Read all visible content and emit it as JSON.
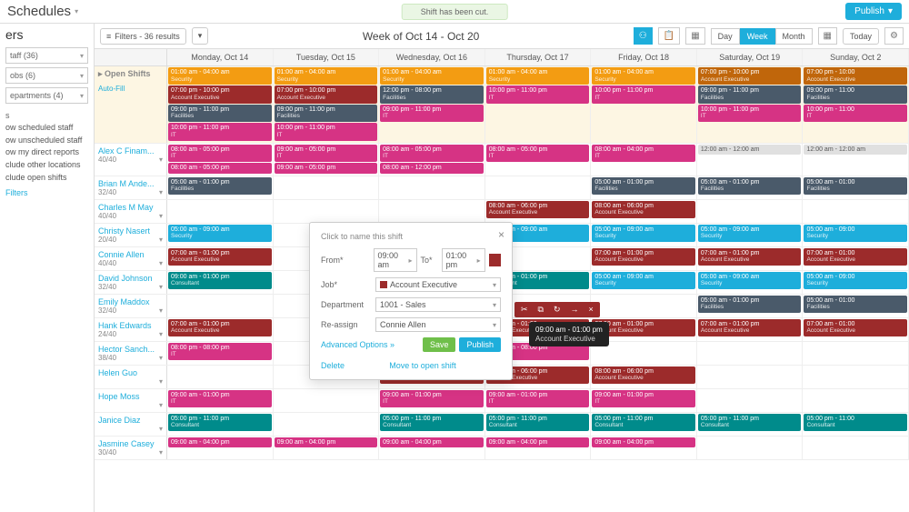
{
  "header": {
    "title": "Schedules",
    "notification": "Shift has been cut.",
    "publish": "Publish"
  },
  "sidebar": {
    "title": "ers",
    "staff": "taff (36)",
    "jobs": "obs (6)",
    "departments": "epartments (4)",
    "options_head": "s",
    "options": [
      "ow scheduled staff",
      "ow unscheduled staff",
      "ow my direct reports",
      "clude other locations",
      "clude open shifts"
    ],
    "clear": "Filters"
  },
  "toolbar": {
    "filters": "Filters - 36 results",
    "week": "Week of Oct 14 - Oct 20",
    "views": {
      "day": "Day",
      "week": "Week",
      "month": "Month",
      "today": "Today"
    }
  },
  "days": [
    "Monday, Oct 14",
    "Tuesday, Oct 15",
    "Wednesday, Oct 16",
    "Thursday, Oct 17",
    "Friday, Oct 18",
    "Saturday, Oct 19",
    "Sunday, Oct 2"
  ],
  "open_label": "Open Shifts",
  "autofill": "Auto-Fill",
  "open_shifts": [
    [
      {
        "t": "01:00 am - 04:00 am",
        "j": "Security",
        "c": "c-orange"
      },
      {
        "t": "07:00 pm - 10:00 pm",
        "j": "Account Executive",
        "c": "c-maroon"
      },
      {
        "t": "09:00 pm - 11:00 pm",
        "j": "Facilities",
        "c": "c-slate"
      },
      {
        "t": "10:00 pm - 11:00 pm",
        "j": "IT",
        "c": "c-pink"
      }
    ],
    [
      {
        "t": "01:00 am - 04:00 am",
        "j": "Security",
        "c": "c-orange"
      },
      {
        "t": "07:00 pm - 10:00 pm",
        "j": "Account Executive",
        "c": "c-maroon"
      },
      {
        "t": "09:00 pm - 11:00 pm",
        "j": "Facilities",
        "c": "c-slate"
      },
      {
        "t": "10:00 pm - 11:00 pm",
        "j": "IT",
        "c": "c-pink"
      }
    ],
    [
      {
        "t": "01:00 am - 04:00 am",
        "j": "Security",
        "c": "c-orange"
      },
      {
        "t": "12:00 pm - 08:00 pm",
        "j": "Facilities",
        "c": "c-slate"
      },
      {
        "t": "09:00 pm - 11:00 pm",
        "j": "IT",
        "c": "c-pink"
      }
    ],
    [
      {
        "t": "01:00 am - 04:00 am",
        "j": "Security",
        "c": "c-orange"
      },
      {
        "t": "10:00 pm - 11:00 pm",
        "j": "IT",
        "c": "c-pink"
      }
    ],
    [
      {
        "t": "01:00 am - 04:00 am",
        "j": "Security",
        "c": "c-orange"
      },
      {
        "t": "10:00 pm - 11:00 pm",
        "j": "IT",
        "c": "c-pink"
      }
    ],
    [
      {
        "t": "07:00 pm - 10:00 pm",
        "j": "Account Executive",
        "c": "c-dorange"
      },
      {
        "t": "09:00 pm - 11:00 pm",
        "j": "Facilities",
        "c": "c-slate"
      },
      {
        "t": "10:00 pm - 11:00 pm",
        "j": "IT",
        "c": "c-pink"
      }
    ],
    [
      {
        "t": "07:00 pm - 10:00",
        "j": "Account Executive",
        "c": "c-dorange"
      },
      {
        "t": "09:00 pm - 11:00",
        "j": "Facilities",
        "c": "c-slate"
      },
      {
        "t": "10:00 pm - 11:00",
        "j": "IT",
        "c": "c-pink"
      }
    ]
  ],
  "employees": [
    {
      "name": "Alex C Finam...",
      "hrs": "40/40",
      "cells": [
        [
          {
            "t": "08:00 am - 05:00 pm",
            "j": "IT",
            "c": "c-pink"
          },
          {
            "t": "08:00 am - 05:00 pm",
            "j": "",
            "c": "c-pink"
          }
        ],
        [
          {
            "t": "09:00 am - 05:00 pm",
            "j": "IT",
            "c": "c-pink"
          },
          {
            "t": "09:00 am - 05:00 pm",
            "j": "",
            "c": "c-pink"
          }
        ],
        [
          {
            "t": "08:00 am - 05:00 pm",
            "j": "IT",
            "c": "c-pink"
          },
          {
            "t": "08:00 am - 12:00 pm",
            "j": "",
            "c": "c-pink"
          }
        ],
        [
          {
            "t": "08:00 am - 05:00 pm",
            "j": "IT",
            "c": "c-pink"
          }
        ],
        [
          {
            "t": "08:00 am - 04:00 pm",
            "j": "IT",
            "c": "c-pink"
          }
        ],
        [
          {
            "t": "12:00 am - 12:00 am",
            "j": "",
            "c": "c-grey"
          }
        ],
        [
          {
            "t": "12:00 am - 12:00 am",
            "j": "",
            "c": "c-grey"
          }
        ]
      ]
    },
    {
      "name": "Brian M Ande...",
      "hrs": "32/40",
      "cells": [
        [
          {
            "t": "05:00 am - 01:00 pm",
            "j": "Facilities",
            "c": "c-slate"
          }
        ],
        [],
        [],
        [],
        [
          {
            "t": "05:00 am - 01:00 pm",
            "j": "Facilities",
            "c": "c-slate"
          }
        ],
        [
          {
            "t": "05:00 am - 01:00 pm",
            "j": "Facilities",
            "c": "c-slate"
          }
        ],
        [
          {
            "t": "05:00 am - 01:00",
            "j": "Facilities",
            "c": "c-slate"
          }
        ]
      ]
    },
    {
      "name": "Charles M May",
      "hrs": "40/40",
      "cells": [
        [],
        [],
        [],
        [
          {
            "t": "08:00 am - 06:00 pm",
            "j": "Account Executive",
            "c": "c-maroon"
          }
        ],
        [
          {
            "t": "08:00 am - 06:00 pm",
            "j": "Account Executive",
            "c": "c-maroon"
          }
        ],
        [],
        []
      ]
    },
    {
      "name": "Christy Nasert",
      "hrs": "20/40",
      "cells": [
        [
          {
            "t": "05:00 am - 09:00 am",
            "j": "Security",
            "c": "c-cyan"
          }
        ],
        [],
        [],
        [
          {
            "t": "05:00 am - 09:00 am",
            "j": "Security",
            "c": "c-cyan"
          }
        ],
        [
          {
            "t": "05:00 am - 09:00 am",
            "j": "Security",
            "c": "c-cyan"
          }
        ],
        [
          {
            "t": "05:00 am - 09:00 am",
            "j": "Security",
            "c": "c-cyan"
          }
        ],
        [
          {
            "t": "05:00 am - 09:00",
            "j": "Security",
            "c": "c-cyan"
          }
        ]
      ]
    },
    {
      "name": "Connie Allen",
      "hrs": "40/40",
      "cells": [
        [
          {
            "t": "07:00 am - 01:00 pm",
            "j": "Account Executive",
            "c": "c-maroon"
          }
        ],
        [],
        [],
        [],
        [
          {
            "t": "07:00 am - 01:00 pm",
            "j": "Account Executive",
            "c": "c-maroon"
          }
        ],
        [
          {
            "t": "07:00 am - 01:00 pm",
            "j": "Account Executive",
            "c": "c-maroon"
          }
        ],
        [
          {
            "t": "07:00 am - 01:00",
            "j": "Account Executive",
            "c": "c-maroon"
          }
        ]
      ]
    },
    {
      "name": "David Johnson",
      "hrs": "32/40",
      "cells": [
        [
          {
            "t": "09:00 am - 01:00 pm",
            "j": "Consultant",
            "c": "c-teal"
          }
        ],
        [],
        [],
        [
          {
            "t": "09:00 am - 01:00 pm",
            "j": "Consultant",
            "c": "c-teal"
          }
        ],
        [
          {
            "t": "05:00 am - 09:00 am",
            "j": "Security",
            "c": "c-cyan"
          }
        ],
        [
          {
            "t": "05:00 am - 09:00 am",
            "j": "Security",
            "c": "c-cyan"
          }
        ],
        [
          {
            "t": "05:00 am - 09:00",
            "j": "Security",
            "c": "c-cyan"
          }
        ]
      ]
    },
    {
      "name": "Emily Maddox",
      "hrs": "32/40",
      "cells": [
        [],
        [],
        [],
        [],
        [],
        [
          {
            "t": "05:00 am - 01:00 pm",
            "j": "Facilities",
            "c": "c-slate"
          }
        ],
        [
          {
            "t": "05:00 am - 01:00",
            "j": "Facilities",
            "c": "c-slate"
          }
        ]
      ]
    },
    {
      "name": "Hank Edwards",
      "hrs": "24/40",
      "cells": [
        [
          {
            "t": "07:00 am - 01:00 pm",
            "j": "Account Executive",
            "c": "c-maroon"
          }
        ],
        [],
        [],
        [
          {
            "t": "07:00 am - 01:00 pm",
            "j": "Account Executive",
            "c": "c-maroon"
          }
        ],
        [
          {
            "t": "07:00 am - 01:00 pm",
            "j": "Account Executive",
            "c": "c-maroon"
          }
        ],
        [
          {
            "t": "07:00 am - 01:00 pm",
            "j": "Account Executive",
            "c": "c-maroon"
          }
        ],
        [
          {
            "t": "07:00 am - 01:00",
            "j": "Account Executive",
            "c": "c-maroon"
          }
        ]
      ]
    },
    {
      "name": "Hector Sanch...",
      "hrs": "38/40",
      "cells": [
        [
          {
            "t": "08:00 pm - 08:00 pm",
            "j": "IT",
            "c": "c-pink"
          }
        ],
        [],
        [],
        [
          {
            "t": "08:00 pm - 08:00 pm",
            "j": "IT",
            "c": "c-pink"
          }
        ],
        [],
        [],
        []
      ]
    },
    {
      "name": "Helen Guo",
      "hrs": "",
      "cells": [
        [],
        [],
        [
          {
            "t": "08:00 am - 06:00 pm",
            "j": "Account Executive",
            "c": "c-maroon"
          }
        ],
        [
          {
            "t": "08:00 am - 06:00 pm",
            "j": "Account Executive",
            "c": "c-maroon"
          }
        ],
        [
          {
            "t": "08:00 am - 06:00 pm",
            "j": "Account Executive",
            "c": "c-maroon"
          }
        ],
        [],
        []
      ]
    },
    {
      "name": "Hope Moss",
      "hrs": "",
      "cells": [
        [
          {
            "t": "09:00 am - 01:00 pm",
            "j": "IT",
            "c": "c-pink"
          }
        ],
        [],
        [
          {
            "t": "09:00 am - 01:00 pm",
            "j": "IT",
            "c": "c-pink"
          }
        ],
        [
          {
            "t": "09:00 am - 01:00 pm",
            "j": "IT",
            "c": "c-pink"
          }
        ],
        [
          {
            "t": "09:00 am - 01:00 pm",
            "j": "IT",
            "c": "c-pink"
          }
        ],
        [],
        []
      ]
    },
    {
      "name": "Janice Diaz",
      "hrs": "",
      "cells": [
        [
          {
            "t": "05:00 pm - 11:00 pm",
            "j": "Consultant",
            "c": "c-teal"
          }
        ],
        [],
        [
          {
            "t": "05:00 pm - 11:00 pm",
            "j": "Consultant",
            "c": "c-teal"
          }
        ],
        [
          {
            "t": "05:00 pm - 11:00 pm",
            "j": "Consultant",
            "c": "c-teal"
          }
        ],
        [
          {
            "t": "05:00 pm - 11:00 pm",
            "j": "Consultant",
            "c": "c-teal"
          }
        ],
        [
          {
            "t": "05:00 pm - 11:00 pm",
            "j": "Consultant",
            "c": "c-teal"
          }
        ],
        [
          {
            "t": "05:00 pm - 11:00",
            "j": "Consultant",
            "c": "c-teal"
          }
        ]
      ]
    },
    {
      "name": "Jasmine Casey",
      "hrs": "30/40",
      "cells": [
        [
          {
            "t": "09:00 am - 04:00 pm",
            "j": "",
            "c": "c-pink"
          }
        ],
        [
          {
            "t": "09:00 am - 04:00 pm",
            "j": "",
            "c": "c-pink"
          }
        ],
        [
          {
            "t": "09:00 am - 04:00 pm",
            "j": "",
            "c": "c-pink"
          }
        ],
        [
          {
            "t": "09:00 am - 04:00 pm",
            "j": "",
            "c": "c-pink"
          }
        ],
        [
          {
            "t": "09:00 am - 04:00 pm",
            "j": "",
            "c": "c-pink"
          }
        ],
        [],
        []
      ]
    }
  ],
  "popover": {
    "title": "Click to name this shift",
    "from_lbl": "From*",
    "from": "09:00 am",
    "to_lbl": "To*",
    "to": "01:00 pm",
    "job_lbl": "Job*",
    "job": "Account Executive",
    "dept_lbl": "Department",
    "dept": "1001 - Sales",
    "reassign_lbl": "Re-assign",
    "reassign": "Connie Allen",
    "adv": "Advanced Options »",
    "save": "Save",
    "publish": "Publish",
    "delete": "Delete",
    "move": "Move to open shift"
  },
  "tooltip": {
    "line1": "09:00 am - 01:00 pm",
    "line2": "Account Executive"
  }
}
